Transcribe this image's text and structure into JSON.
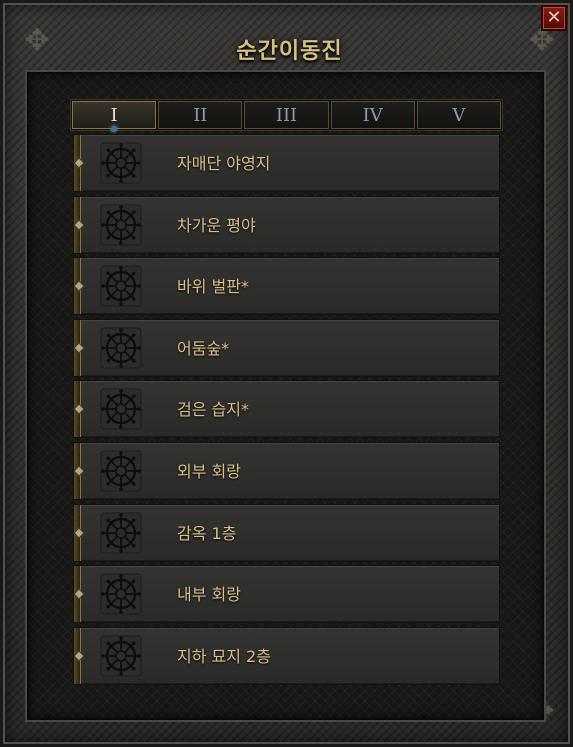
{
  "window": {
    "title": "순간이동진",
    "close_glyph": "✕"
  },
  "tabs": [
    {
      "label": "I",
      "active": true
    },
    {
      "label": "II",
      "active": false
    },
    {
      "label": "III",
      "active": false
    },
    {
      "label": "IV",
      "active": false
    },
    {
      "label": "V",
      "active": false
    }
  ],
  "waypoints": [
    {
      "label": "자매단 야영지",
      "icon": "waypoint-rune-icon"
    },
    {
      "label": "차가운 평야",
      "icon": "waypoint-rune-icon"
    },
    {
      "label": "바위 벌판*",
      "icon": "waypoint-rune-icon"
    },
    {
      "label": "어둠숲*",
      "icon": "waypoint-rune-icon"
    },
    {
      "label": "검은 습지*",
      "icon": "waypoint-rune-icon"
    },
    {
      "label": "외부 회랑",
      "icon": "waypoint-rune-icon"
    },
    {
      "label": "감옥 1층",
      "icon": "waypoint-rune-icon"
    },
    {
      "label": "내부 회랑",
      "icon": "waypoint-rune-icon"
    },
    {
      "label": "지하 묘지 2층",
      "icon": "waypoint-rune-icon"
    }
  ],
  "colors": {
    "label_gold": "#d9c08a",
    "title_gold": "#d8bf84",
    "close_red": "#8a1b12",
    "active_tab_marker": "#3f6f98"
  }
}
